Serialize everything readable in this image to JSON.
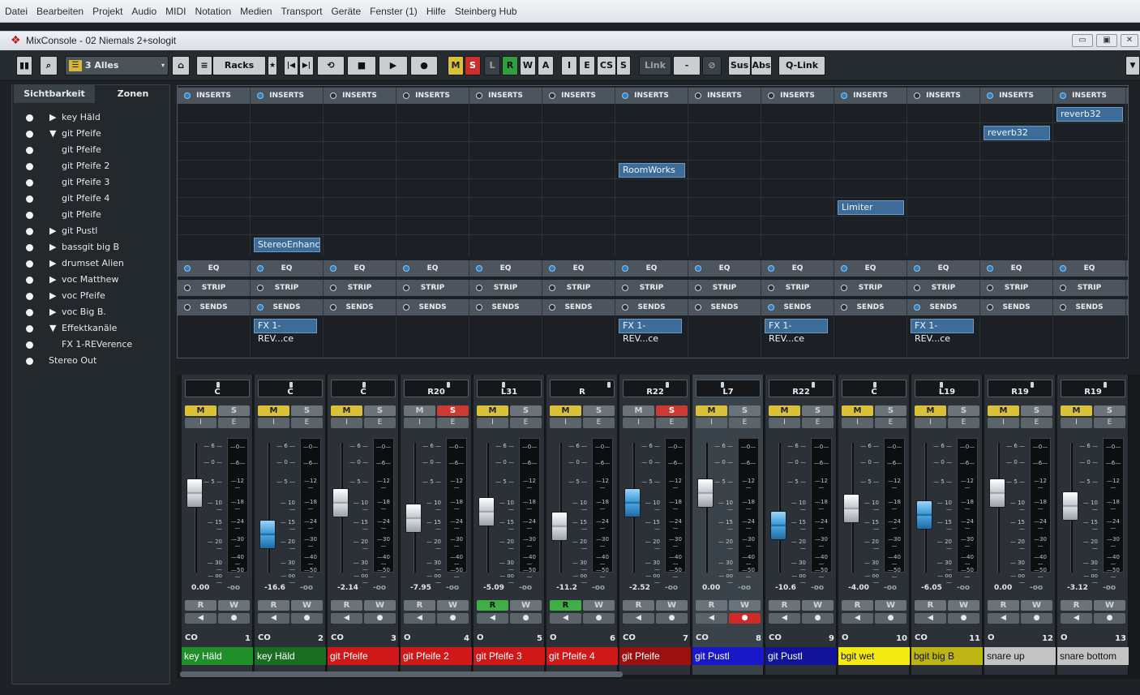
{
  "menu": [
    "Datei",
    "Bearbeiten",
    "Projekt",
    "Audio",
    "MIDI",
    "Notation",
    "Medien",
    "Transport",
    "Geräte",
    "Fenster (1)",
    "Hilfe",
    "Steinberg Hub"
  ],
  "window": {
    "title": "MixConsole - 02 Niemals 2+sologit",
    "minimize": "▭",
    "maximize": "▣",
    "close": "✕"
  },
  "toolbar": {
    "config_preset": "3 Alles",
    "racks_label": "Racks",
    "star": "★",
    "goto_prev": "|◀",
    "goto_next": "▶|",
    "cycle": "⟲",
    "stop": "■",
    "play": "▶",
    "record": "●",
    "m": "M",
    "s": "S",
    "l": "L",
    "r": "R",
    "w": "W",
    "a": "A",
    "i": "I",
    "e": "E",
    "cs": "CS",
    "s2": "S",
    "link": "Link",
    "link_value": "-",
    "sus": "Sus",
    "abs": "Abs",
    "qlink": "Q-Link",
    "menu_arrow": "▼"
  },
  "left_panel": {
    "tab_visibility": "Sichtbarkeit",
    "tab_zones": "Zonen",
    "items": [
      {
        "label": "key Häld",
        "indent": 1,
        "arrow": "right"
      },
      {
        "label": "git Pfeife",
        "indent": 1,
        "arrow": "down"
      },
      {
        "label": "git Pfeife",
        "indent": 2,
        "arrow": ""
      },
      {
        "label": "git Pfeife 2",
        "indent": 2,
        "arrow": ""
      },
      {
        "label": "git Pfeife 3",
        "indent": 2,
        "arrow": ""
      },
      {
        "label": "git Pfeife 4",
        "indent": 2,
        "arrow": ""
      },
      {
        "label": "git Pfeife",
        "indent": 2,
        "arrow": ""
      },
      {
        "label": "git Pustl",
        "indent": 1,
        "arrow": "right"
      },
      {
        "label": "bassgit big B",
        "indent": 1,
        "arrow": "right"
      },
      {
        "label": "drumset Alien",
        "indent": 1,
        "arrow": "right"
      },
      {
        "label": "voc Matthew",
        "indent": 1,
        "arrow": "right"
      },
      {
        "label": "voc Pfeife",
        "indent": 1,
        "arrow": "right"
      },
      {
        "label": "voc Big B.",
        "indent": 1,
        "arrow": "right"
      },
      {
        "label": "Effektkanäle",
        "indent": 1,
        "arrow": "down"
      },
      {
        "label": "FX 1-REVerence",
        "indent": 2,
        "arrow": ""
      },
      {
        "label": "Stereo Out",
        "indent": 0,
        "arrow": ""
      }
    ]
  },
  "racks": {
    "inserts_label": "INSERTS",
    "eq_label": "EQ",
    "strip_label": "STRIP",
    "sends_label": "SENDS",
    "inserts": [
      {
        "col": 1,
        "slot": 7,
        "name": "StereoEnhanc"
      },
      {
        "col": 6,
        "slot": 3,
        "name": "RoomWorks"
      },
      {
        "col": 9,
        "slot": 5,
        "name": "Limiter"
      },
      {
        "col": 11,
        "slot": 1,
        "name": "reverb32"
      },
      {
        "col": 12,
        "slot": 0,
        "name": "reverb32"
      }
    ],
    "sends": [
      {
        "col": 1,
        "name": "FX 1-REV...ce"
      },
      {
        "col": 6,
        "name": "FX 1-REV...ce"
      },
      {
        "col": 8,
        "name": "FX 1-REV...ce"
      },
      {
        "col": 10,
        "name": "FX 1-REV...ce"
      }
    ]
  },
  "meter_scale": [
    "0",
    "6",
    "12",
    "18",
    "24",
    "30",
    "40",
    "50"
  ],
  "fader_scale": [
    "6",
    "0",
    "5",
    "10",
    "15",
    "20",
    "30",
    "oo"
  ],
  "channels": [
    {
      "num": "1",
      "name": "key Häld",
      "color": "#1f8f2a",
      "text": "#ffffff",
      "pan": "C",
      "m": true,
      "s": false,
      "r": false,
      "rec": false,
      "vol": "0.00",
      "peak": "-oo",
      "stereo": "CO",
      "cap": "white",
      "fader": 0.36,
      "sel": false
    },
    {
      "num": "2",
      "name": "key Häld",
      "color": "#1a6e22",
      "text": "#ffffff",
      "pan": "C",
      "m": true,
      "s": false,
      "r": false,
      "rec": false,
      "vol": "-16.6",
      "peak": "-oo",
      "stereo": "CO",
      "cap": "blue",
      "fader": 0.72,
      "sel": false
    },
    {
      "num": "3",
      "name": "git Pfeife",
      "color": "#d01818",
      "text": "#ffffff",
      "pan": "C",
      "m": true,
      "s": false,
      "r": false,
      "rec": false,
      "vol": "-2.14",
      "peak": "-oo",
      "stereo": "CO",
      "cap": "white",
      "fader": 0.44,
      "sel": false
    },
    {
      "num": "4",
      "name": "git Pfeife 2",
      "color": "#d01818",
      "text": "#ffffff",
      "pan": "R20",
      "m": false,
      "s": true,
      "r": false,
      "rec": false,
      "vol": "-7.95",
      "peak": "-oo",
      "stereo": "O",
      "cap": "white",
      "fader": 0.58,
      "sel": false
    },
    {
      "num": "5",
      "name": "git Pfeife 3",
      "color": "#d01818",
      "text": "#ffffff",
      "pan": "L31",
      "m": true,
      "s": false,
      "r": true,
      "rec": false,
      "vol": "-5.09",
      "peak": "-oo",
      "stereo": "O",
      "cap": "white",
      "fader": 0.52,
      "sel": false
    },
    {
      "num": "6",
      "name": "git Pfeife 4",
      "color": "#d01818",
      "text": "#ffffff",
      "pan": "R",
      "m": true,
      "s": false,
      "r": true,
      "rec": false,
      "vol": "-11.2",
      "peak": "-oo",
      "stereo": "O",
      "cap": "white",
      "fader": 0.65,
      "sel": false
    },
    {
      "num": "7",
      "name": "git Pfeife",
      "color": "#9b1010",
      "text": "#ffffff",
      "pan": "R22",
      "m": false,
      "s": true,
      "r": false,
      "rec": false,
      "vol": "-2.52",
      "peak": "-oo",
      "stereo": "CO",
      "cap": "blue",
      "fader": 0.44,
      "sel": false
    },
    {
      "num": "8",
      "name": "git Pustl",
      "color": "#1818c8",
      "text": "#ffffff",
      "pan": "L7",
      "m": true,
      "s": false,
      "r": false,
      "rec": true,
      "vol": "0.00",
      "peak": "-oo",
      "stereo": "CO",
      "cap": "white",
      "fader": 0.36,
      "sel": true
    },
    {
      "num": "9",
      "name": "git Pustl",
      "color": "#12129a",
      "text": "#ffffff",
      "pan": "R22",
      "m": true,
      "s": false,
      "r": false,
      "rec": false,
      "vol": "-10.6",
      "peak": "-oo",
      "stereo": "CO",
      "cap": "blue",
      "fader": 0.64,
      "sel": false
    },
    {
      "num": "10",
      "name": "bgit wet",
      "color": "#f2ea10",
      "text": "#111111",
      "pan": "C",
      "m": true,
      "s": false,
      "r": false,
      "rec": false,
      "vol": "-4.00",
      "peak": "-oo",
      "stereo": "O",
      "cap": "white",
      "fader": 0.49,
      "sel": false
    },
    {
      "num": "11",
      "name": "bgit big B",
      "color": "#bdb514",
      "text": "#111111",
      "pan": "L19",
      "m": true,
      "s": false,
      "r": false,
      "rec": false,
      "vol": "-6.05",
      "peak": "-oo",
      "stereo": "CO",
      "cap": "blue",
      "fader": 0.55,
      "sel": false
    },
    {
      "num": "12",
      "name": "snare up",
      "color": "#c3c3c3",
      "text": "#111111",
      "pan": "R19",
      "m": true,
      "s": false,
      "r": false,
      "rec": false,
      "vol": "0.00",
      "peak": "-oo",
      "stereo": "O",
      "cap": "white",
      "fader": 0.36,
      "sel": false
    },
    {
      "num": "13",
      "name": "snare bottom",
      "color": "#c3c3c3",
      "text": "#111111",
      "pan": "R19",
      "m": true,
      "s": false,
      "r": false,
      "rec": false,
      "vol": "-3.12",
      "peak": "-oo",
      "stereo": "O",
      "cap": "white",
      "fader": 0.47,
      "sel": false
    }
  ],
  "strip_buttons": {
    "m": "M",
    "s": "S",
    "i": "I",
    "e": "E",
    "r": "R",
    "w": "W",
    "mon": "◀",
    "rec": "●"
  }
}
